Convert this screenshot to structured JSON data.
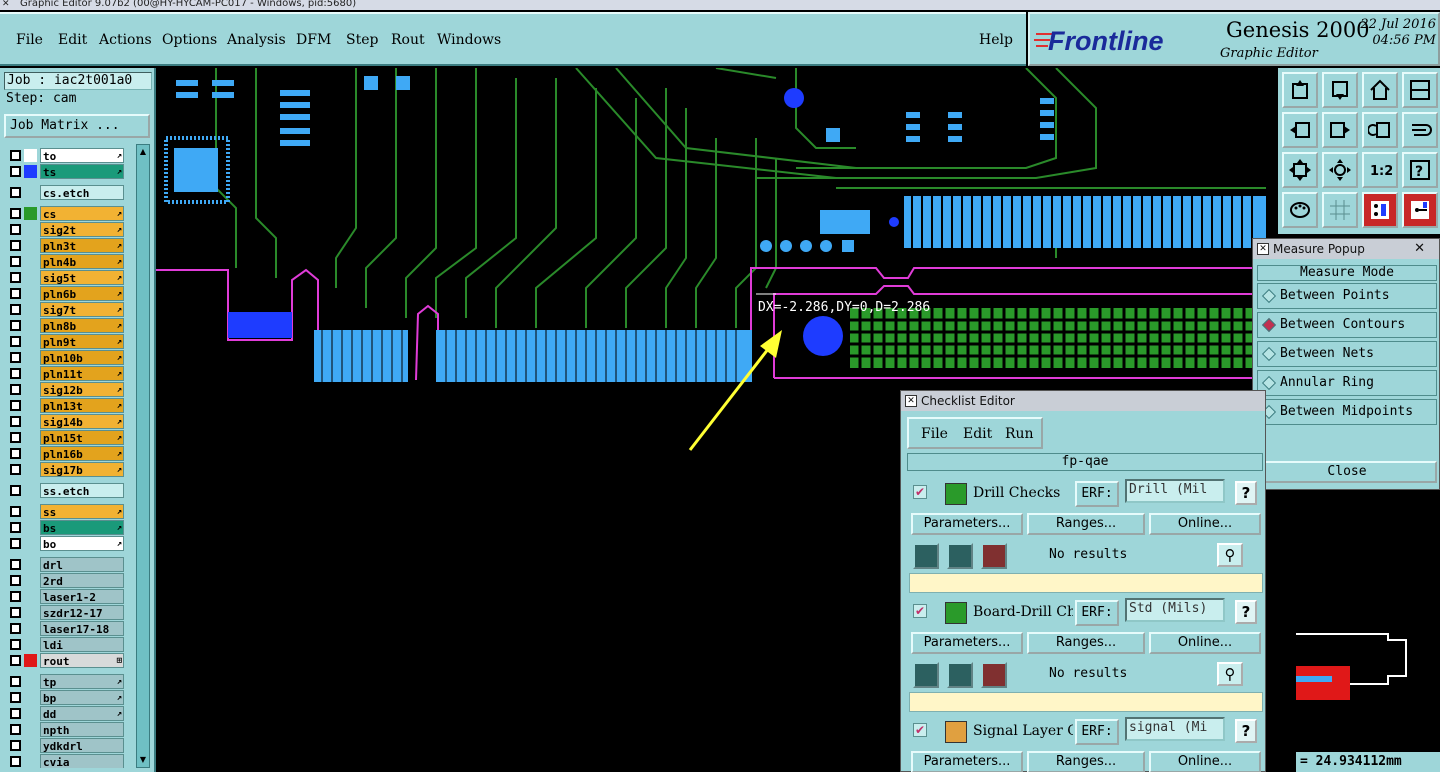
{
  "window": {
    "title": "Graphic Editor 9.07b2 (00@HY-HYCAM-PC017 - Windows, pid:5680)"
  },
  "menu": {
    "items": [
      "File",
      "Edit",
      "Actions",
      "Options",
      "Analysis",
      "DFM",
      "Step",
      "Rout",
      "Windows"
    ],
    "help": "Help"
  },
  "brand": {
    "logo": "Frontline",
    "product": "Genesis 2000",
    "subtitle": "Graphic Editor",
    "date": "22 Jul 2016",
    "time": "04:56 PM"
  },
  "job": {
    "job_line": "Job : iac2t001a0",
    "step_line": "Step: cam",
    "matrix_button": "Job Matrix ..."
  },
  "layers": [
    {
      "name": "to",
      "color": "#ffffff",
      "swatch": "#ffffff",
      "arrow": "↗",
      "group": 1
    },
    {
      "name": "ts",
      "color": "#1a9a7a",
      "swatch": "#1e3cff",
      "arrow": "↗",
      "group": 1
    },
    {
      "name": "cs.etch",
      "color": "#c9eeee",
      "swatch": "#9ed6d9",
      "arrow": "",
      "group": 2
    },
    {
      "name": "cs",
      "color": "#f2b233",
      "swatch": "#2a9a2a",
      "arrow": "↗",
      "group": 3
    },
    {
      "name": "sig2t",
      "color": "#f2b233",
      "swatch": "#9ed6d9",
      "arrow": "↗",
      "group": 3
    },
    {
      "name": "pln3t",
      "color": "#e3a31d",
      "swatch": "#9ed6d9",
      "arrow": "↗",
      "group": 3
    },
    {
      "name": "pln4b",
      "color": "#e3a31d",
      "swatch": "#9ed6d9",
      "arrow": "↗",
      "group": 3
    },
    {
      "name": "sig5t",
      "color": "#f2b233",
      "swatch": "#9ed6d9",
      "arrow": "↗",
      "group": 3
    },
    {
      "name": "pln6b",
      "color": "#e3a31d",
      "swatch": "#9ed6d9",
      "arrow": "↗",
      "group": 3
    },
    {
      "name": "sig7t",
      "color": "#f2b233",
      "swatch": "#9ed6d9",
      "arrow": "↗",
      "group": 3
    },
    {
      "name": "pln8b",
      "color": "#e3a31d",
      "swatch": "#9ed6d9",
      "arrow": "↗",
      "group": 3
    },
    {
      "name": "pln9t",
      "color": "#e3a31d",
      "swatch": "#9ed6d9",
      "arrow": "↗",
      "group": 3
    },
    {
      "name": "pln10b",
      "color": "#e3a31d",
      "swatch": "#9ed6d9",
      "arrow": "↗",
      "group": 3
    },
    {
      "name": "pln11t",
      "color": "#e3a31d",
      "swatch": "#9ed6d9",
      "arrow": "↗",
      "group": 3
    },
    {
      "name": "sig12b",
      "color": "#f2b233",
      "swatch": "#9ed6d9",
      "arrow": "↗",
      "group": 3
    },
    {
      "name": "pln13t",
      "color": "#e3a31d",
      "swatch": "#9ed6d9",
      "arrow": "↗",
      "group": 3
    },
    {
      "name": "sig14b",
      "color": "#f2b233",
      "swatch": "#9ed6d9",
      "arrow": "↗",
      "group": 3
    },
    {
      "name": "pln15t",
      "color": "#e3a31d",
      "swatch": "#9ed6d9",
      "arrow": "↗",
      "group": 3
    },
    {
      "name": "pln16b",
      "color": "#e3a31d",
      "swatch": "#9ed6d9",
      "arrow": "↗",
      "group": 3
    },
    {
      "name": "sig17b",
      "color": "#f2b233",
      "swatch": "#9ed6d9",
      "arrow": "↗",
      "group": 3
    },
    {
      "name": "ss.etch",
      "color": "#c9eeee",
      "swatch": "#9ed6d9",
      "arrow": "",
      "group": 4
    },
    {
      "name": "ss",
      "color": "#f2b233",
      "swatch": "#9ed6d9",
      "arrow": "↗",
      "group": 5
    },
    {
      "name": "bs",
      "color": "#1a9a7a",
      "swatch": "#9ed6d9",
      "arrow": "↗",
      "group": 5
    },
    {
      "name": "bo",
      "color": "#ffffff",
      "swatch": "#9ed6d9",
      "arrow": "↗",
      "group": 5
    },
    {
      "name": "drl",
      "color": "#9fc4c8",
      "swatch": "#9ed6d9",
      "arrow": "",
      "group": 6
    },
    {
      "name": "2rd",
      "color": "#9fc4c8",
      "swatch": "#9ed6d9",
      "arrow": "",
      "group": 6
    },
    {
      "name": "laser1-2",
      "color": "#9fc4c8",
      "swatch": "#9ed6d9",
      "arrow": "",
      "group": 6
    },
    {
      "name": "szdr12-17",
      "color": "#9fc4c8",
      "swatch": "#9ed6d9",
      "arrow": "",
      "group": 6
    },
    {
      "name": "laser17-18",
      "color": "#9fc4c8",
      "swatch": "#9ed6d9",
      "arrow": "",
      "group": 6
    },
    {
      "name": "ldi",
      "color": "#9fc4c8",
      "swatch": "#9ed6d9",
      "arrow": "",
      "group": 6
    },
    {
      "name": "rout",
      "color": "#d8dada",
      "swatch": "#e01818",
      "arrow": "⊞",
      "group": 6
    },
    {
      "name": "tp",
      "color": "#9fc4c8",
      "swatch": "#9ed6d9",
      "arrow": "↗",
      "group": 7
    },
    {
      "name": "bp",
      "color": "#9fc4c8",
      "swatch": "#9ed6d9",
      "arrow": "↗",
      "group": 7
    },
    {
      "name": "dd",
      "color": "#9fc4c8",
      "swatch": "#9ed6d9",
      "arrow": "↗",
      "group": 7
    },
    {
      "name": "npth",
      "color": "#9fc4c8",
      "swatch": "#9ed6d9",
      "arrow": "",
      "group": 7
    },
    {
      "name": "ydkdrl",
      "color": "#9fc4c8",
      "swatch": "#9ed6d9",
      "arrow": "",
      "group": 7
    },
    {
      "name": "cvia",
      "color": "#9fc4c8",
      "swatch": "#9ed6d9",
      "arrow": "",
      "group": 7
    }
  ],
  "measure": {
    "readout": "DX=-2.286,DY=0,D=2.286"
  },
  "measure_popup": {
    "title": "Measure Popup",
    "mode_label": "Measure Mode",
    "options": [
      "Between Points",
      "Between Contours",
      "Between Nets",
      "Annular Ring",
      "Between Midpoints"
    ],
    "selected": "Between Contours",
    "close": "Close"
  },
  "checklist": {
    "title": "Checklist Editor",
    "menu": [
      "File",
      "Edit",
      "Run"
    ],
    "name": "fp-qae",
    "items": [
      {
        "name": "Drill Checks",
        "erf_label": "ERF:",
        "erf": "Drill (Mil",
        "help": "?",
        "params": "Parameters...",
        "ranges": "Ranges...",
        "online": "Online...",
        "result": "No results"
      },
      {
        "name": "Board-Drill Che",
        "erf_label": "ERF:",
        "erf": "Std (Mils)",
        "help": "?",
        "params": "Parameters...",
        "ranges": "Ranges...",
        "online": "Online...",
        "result": "No results"
      },
      {
        "name": "Signal Layer Ch",
        "erf_label": "ERF:",
        "erf": "signal (Mi",
        "help": "?",
        "params": "Parameters...",
        "ranges": "Ranges...",
        "online": "Online...",
        "result": ""
      }
    ]
  },
  "status": {
    "coords": "= 24.934112mm"
  },
  "colors": {
    "panel": "#9ed6d9",
    "board_trace": "#2a8a2a",
    "pad": "#3fa9f5",
    "outline": "#e03cd8",
    "arrow": "#ffff33"
  }
}
